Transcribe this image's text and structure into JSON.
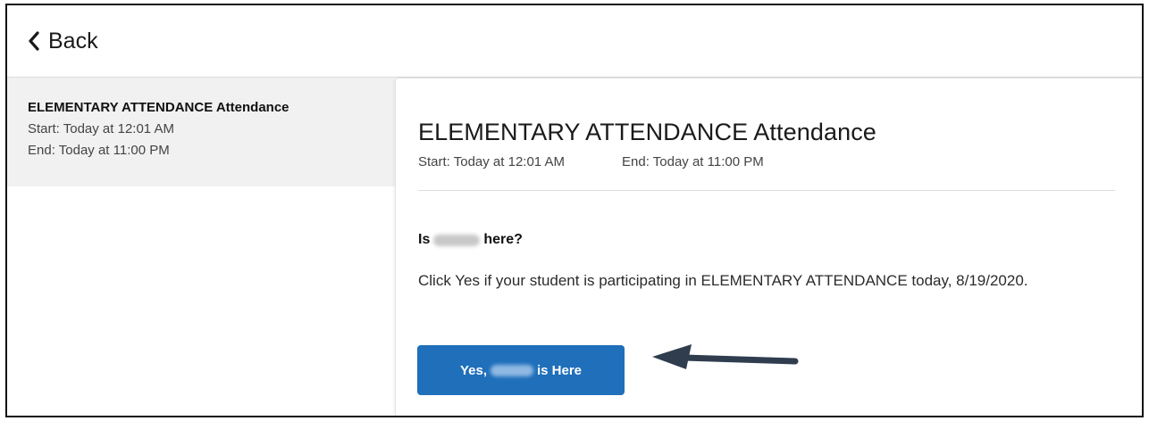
{
  "topbar": {
    "back_label": "Back",
    "back_icon": "chevron-left-icon"
  },
  "sidebar": {
    "items": [
      {
        "title": "ELEMENTARY ATTENDANCE Attendance",
        "start": "Start: Today at 12:01 AM",
        "end": "End: Today at 11:00 PM"
      }
    ]
  },
  "panel": {
    "title": "ELEMENTARY ATTENDANCE Attendance",
    "start": "Start: Today at 12:01 AM",
    "end": "End: Today at 11:00 PM",
    "question_prefix": "Is",
    "question_suffix": "here?",
    "message": "Click Yes if your student is participating in ELEMENTARY ATTENDANCE today, 8/19/2020.",
    "button_prefix": "Yes,",
    "button_suffix": "is Here"
  },
  "colors": {
    "primary_button": "#1f6fba",
    "sidebar_selected": "#f1f1f1",
    "annotation_arrow": "#2f3d4f"
  }
}
